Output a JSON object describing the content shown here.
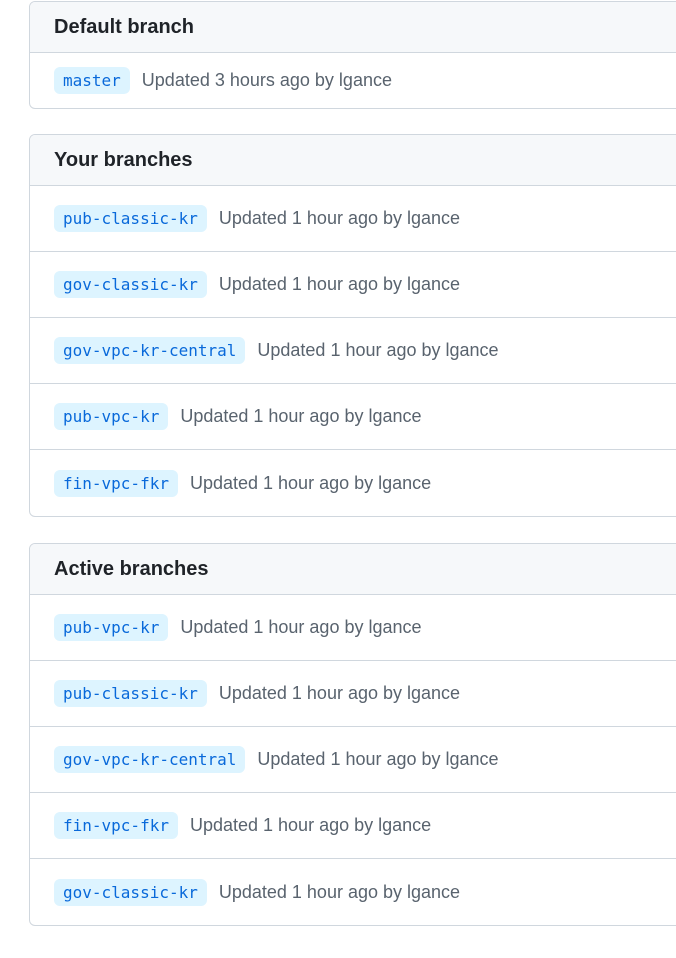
{
  "default_section": {
    "title": "Default branch",
    "rows": [
      {
        "branch": "master",
        "meta": "Updated 3 hours ago by lgance"
      }
    ]
  },
  "your_section": {
    "title": "Your branches",
    "rows": [
      {
        "branch": "pub-classic-kr",
        "meta": "Updated 1 hour ago by lgance"
      },
      {
        "branch": "gov-classic-kr",
        "meta": "Updated 1 hour ago by lgance"
      },
      {
        "branch": "gov-vpc-kr-central",
        "meta": "Updated 1 hour ago by lgance"
      },
      {
        "branch": "pub-vpc-kr",
        "meta": "Updated 1 hour ago by lgance"
      },
      {
        "branch": "fin-vpc-fkr",
        "meta": "Updated 1 hour ago by lgance"
      }
    ]
  },
  "active_section": {
    "title": "Active branches",
    "rows": [
      {
        "branch": "pub-vpc-kr",
        "meta": "Updated 1 hour ago by lgance"
      },
      {
        "branch": "pub-classic-kr",
        "meta": "Updated 1 hour ago by lgance"
      },
      {
        "branch": "gov-vpc-kr-central",
        "meta": "Updated 1 hour ago by lgance"
      },
      {
        "branch": "fin-vpc-fkr",
        "meta": "Updated 1 hour ago by lgance"
      },
      {
        "branch": "gov-classic-kr",
        "meta": "Updated 1 hour ago by lgance"
      }
    ]
  },
  "colors": {
    "branch_text": "#0969da",
    "branch_bg": "#ddf4ff",
    "header_bg": "#f6f8fa",
    "border": "#d0d7de",
    "meta_text": "#59636e"
  }
}
